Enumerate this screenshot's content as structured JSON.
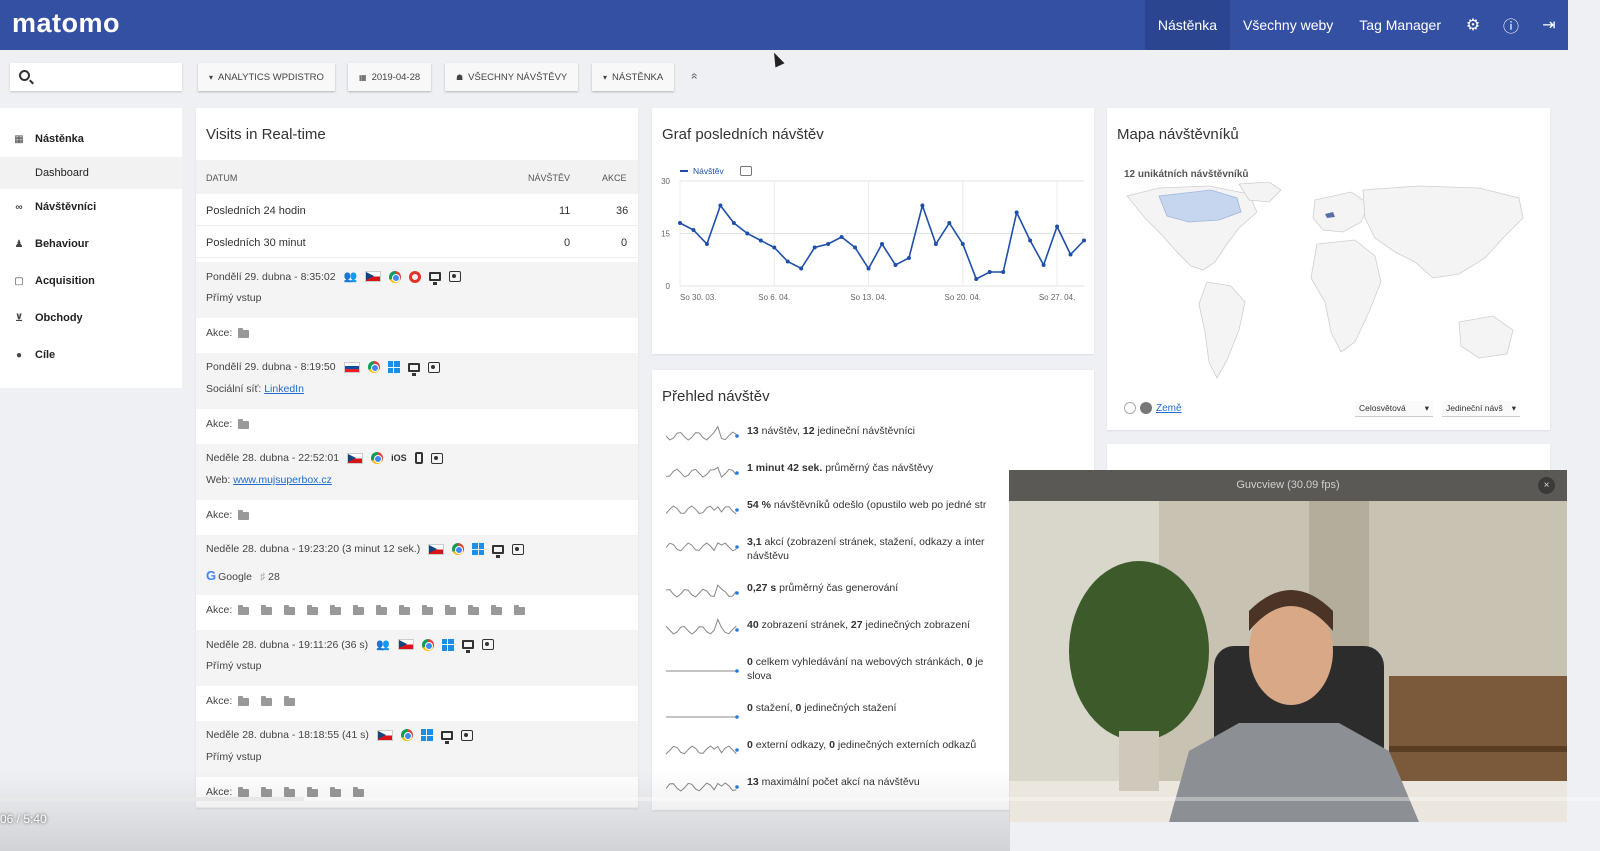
{
  "topbar": {
    "logo": "matomo",
    "nav": [
      "Nástěnka",
      "Všechny weby",
      "Tag Manager"
    ],
    "icons": [
      "gear-icon",
      "info-icon",
      "logout-icon"
    ],
    "accent": "#3450a3"
  },
  "toolbar": {
    "search_value": "",
    "site": "ANALYTICS WPDISTRO",
    "date": "2019-04-28",
    "segment": "VŠECHNY NÁVŠTĚVY",
    "dashboard": "NÁSTĚNKA",
    "collapse": "»"
  },
  "sidebar": {
    "items": [
      {
        "label": "Nástěnka",
        "icon": "grid-icon"
      },
      {
        "label": "Dashboard"
      },
      {
        "label": "Návštěvníci",
        "icon": "visitors-icon"
      },
      {
        "label": "Behaviour",
        "icon": "bell-icon"
      },
      {
        "label": "Acquisition",
        "icon": "square-icon"
      },
      {
        "label": "Obchody",
        "icon": "cart-icon"
      },
      {
        "label": "Cíle",
        "icon": "goal-icon"
      }
    ]
  },
  "realtime": {
    "title": "Visits in Real-time",
    "headers": [
      "DATUM",
      "NÁVŠTĚV",
      "AKCE"
    ],
    "rows": [
      {
        "label": "Posledních 24 hodin",
        "visits": "11",
        "actions": "36"
      },
      {
        "label": "Posledních 30 minut",
        "visits": "0",
        "actions": "0"
      }
    ],
    "akce_label": "Akce:",
    "visits": [
      {
        "time": "Pondělí 29. dubna - 8:35:02",
        "sub": "Přímý vstup",
        "sub_link": "",
        "folders": 1
      },
      {
        "time": "Pondělí 29. dubna - 8:19:50",
        "sub": "Sociální síť: ",
        "sub_link": "LinkedIn",
        "folders": 1
      },
      {
        "time": "Neděle 28. dubna - 22:52:01",
        "sub": "Web: ",
        "sub_link": "www.mujsuperbox.cz",
        "folders": 1,
        "os": "iOS"
      },
      {
        "time": "Neděle 28. dubna - 19:23:20 (3 minut 12 sek.)",
        "sub": "Google",
        "sub_extra": "28",
        "sub_link": "",
        "folders": 13
      },
      {
        "time": "Neděle 28. dubna - 19:11:26 (36 s)",
        "sub": "Přímý vstup",
        "sub_link": "",
        "folders": 3
      },
      {
        "time": "Neděle 28. dubna - 18:18:55 (41 s)",
        "sub": "Přímý vstup",
        "sub_link": "",
        "folders": 6
      }
    ]
  },
  "graph": {
    "title": "Graf posledních návštěv",
    "legend": "Návštěv"
  },
  "chart_data": {
    "type": "line",
    "x": [
      "So 30. 03.",
      "Ne 31. 03.",
      "Po 1. 04.",
      "Út 2. 04.",
      "St 3. 04.",
      "Čt 4. 04.",
      "Pá 5. 04.",
      "So 6. 04.",
      "Ne 7. 04.",
      "Po 8. 04.",
      "Út 9. 04.",
      "St 10. 04.",
      "Čt 11. 04.",
      "Pá 12. 04.",
      "So 13. 04.",
      "Ne 14. 04.",
      "Po 15. 04.",
      "Út 16. 04.",
      "St 17. 04.",
      "Čt 18. 04.",
      "Pá 19. 04.",
      "So 20. 04.",
      "Ne 21. 04.",
      "Po 22. 04.",
      "Út 23. 04.",
      "St 24. 04.",
      "Čt 25. 04.",
      "Pá 26. 04.",
      "So 27. 04.",
      "Ne 28. 04."
    ],
    "tick_labels": [
      "So 30. 03.",
      "So 6. 04.",
      "So 13. 04.",
      "So 20. 04.",
      "So 27. 04."
    ],
    "series": [
      {
        "name": "Návštěv",
        "values": [
          18,
          16,
          12,
          23,
          18,
          15,
          13,
          11,
          7,
          5,
          11,
          12,
          14,
          11,
          5,
          12,
          6,
          8,
          23,
          12,
          18,
          12,
          2,
          4,
          4,
          21,
          13,
          6,
          17,
          9,
          13
        ]
      }
    ],
    "ylim": [
      0,
      30
    ],
    "yticks": [
      0,
      15,
      30
    ],
    "color": "#1f4fa8",
    "grid": true
  },
  "overview": {
    "title": "Přehled návštěv",
    "rows": [
      {
        "b1": "13",
        "t1": " návštěv, ",
        "b2": "12",
        "t2": " jedineční návštěvníci"
      },
      {
        "b1": "1 minut 42 sek.",
        "t1": " průměrný čas návštěvy",
        "b2": "",
        "t2": ""
      },
      {
        "b1": "54 %",
        "t1": " návštěvníků odešlo (opustilo web po jedné str",
        "b2": "",
        "t2": ""
      },
      {
        "b1": "3,1",
        "t1": " akcí (zobrazení stránek, stažení, odkazy a inter",
        "b2": "",
        "t2": "",
        "line2": "návštěvu"
      },
      {
        "b1": "0,27 s",
        "t1": " průměrný čas generování",
        "b2": "",
        "t2": ""
      },
      {
        "b1": "40",
        "t1": " zobrazení stránek, ",
        "b2": "27",
        "t2": " jedinečných zobrazení"
      },
      {
        "b1": "0",
        "t1": " celkem vyhledávání na webových stránkách, ",
        "b2": "0",
        "t2": " je",
        "line2": "slova"
      },
      {
        "b1": "0",
        "t1": " stažení, ",
        "b2": "0",
        "t2": " jedinečných stažení"
      },
      {
        "b1": "0",
        "t1": " externí odkazy, ",
        "b2": "0",
        "t2": " jedinečných externích odkazů"
      },
      {
        "b1": "13",
        "t1": " maximální počet akcí na návštěvu",
        "b2": "",
        "t2": ""
      }
    ]
  },
  "map": {
    "title": "Mapa návštěvníků",
    "subtitle": "12 unikátních návštěvníků",
    "link": "Země",
    "select1": "Celosvětová",
    "select2": "Jedineční návš"
  },
  "webcam": {
    "title": "Guvcview  (30.09 fps)",
    "close": "×"
  },
  "video": {
    "time": "06 / 5:40",
    "progress": 0.19
  }
}
